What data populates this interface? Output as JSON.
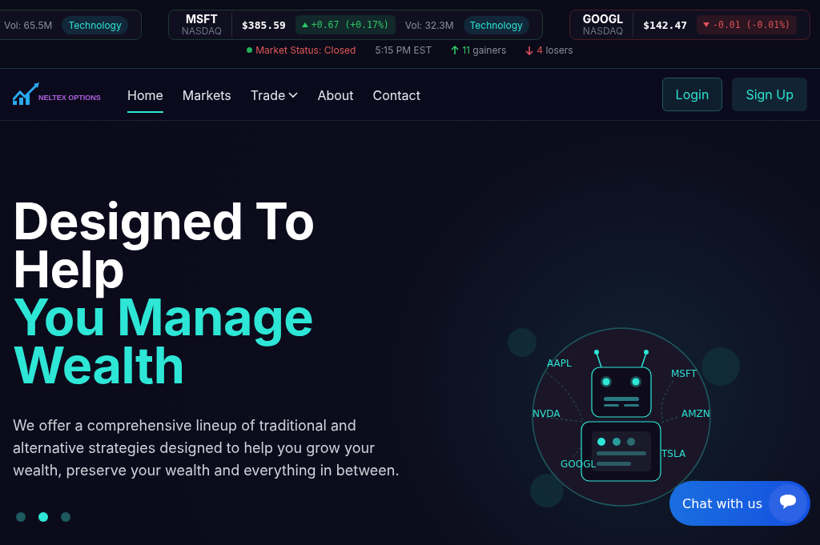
{
  "ticker": {
    "cards": [
      {
        "kind": "partial",
        "volume": "Vol: 65.5M",
        "sector": "Technology"
      },
      {
        "kind": "full",
        "symbol": "MSFT",
        "exchange": "NASDAQ",
        "price": "$385.59",
        "rising": true,
        "change": "+0.67",
        "percent": "(+0.17%)",
        "volume": "Vol: 32.3M",
        "sector": "Technology"
      },
      {
        "kind": "full",
        "symbol": "GOOGL",
        "exchange": "NASDAQ",
        "price": "$142.47",
        "rising": false,
        "change": "-0.01",
        "percent": "(-0.01%)"
      }
    ]
  },
  "market_status": {
    "status": "Market Status: Closed",
    "time": "5:15 PM EST",
    "gainers_count": "11",
    "gainers_label": "gainers",
    "losers_count": "4",
    "losers_label": "losers"
  },
  "navbar": {
    "logo_text": "NELTEX OPTIONS",
    "items": [
      {
        "label": "Home",
        "selected": true,
        "dropdown": false
      },
      {
        "label": "Markets",
        "selected": false,
        "dropdown": false
      },
      {
        "label": "Trade",
        "selected": false,
        "dropdown": true
      },
      {
        "label": "About",
        "selected": false,
        "dropdown": false
      },
      {
        "label": "Contact",
        "selected": false,
        "dropdown": false
      }
    ],
    "login": "Login",
    "signup": "Sign Up"
  },
  "hero": {
    "title_lines": [
      {
        "text": "Designed To",
        "kind": "plain"
      },
      {
        "text": "Help",
        "kind": "plain"
      },
      {
        "text": "You Manage",
        "kind": "accent"
      },
      {
        "text": "Wealth",
        "kind": "accent"
      }
    ],
    "description": "We offer a comprehensive lineup of traditional and alternative strategies designed to help you grow your wealth, preserve your wealth and everything in between.",
    "slides": [
      {
        "selected": false
      },
      {
        "selected": true
      },
      {
        "selected": false
      }
    ],
    "robot_labels": [
      "AAPL",
      "MSFT",
      "NVDA",
      "AMZN",
      "GOOGL",
      "TSLA"
    ]
  },
  "chat": {
    "label": "Chat with us"
  }
}
